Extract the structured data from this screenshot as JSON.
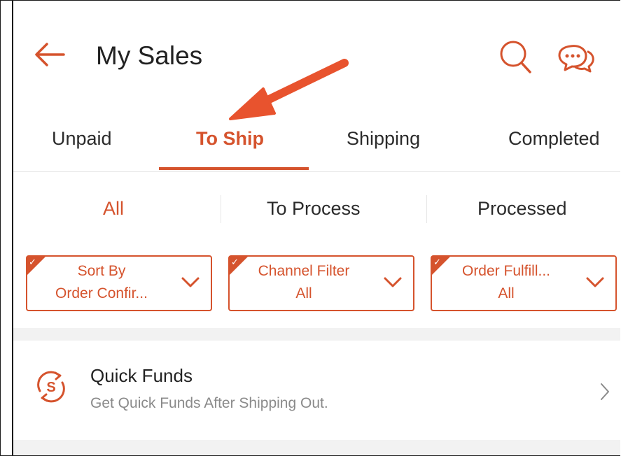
{
  "header": {
    "title": "My Sales",
    "back_icon": "arrow-left-icon",
    "search_icon": "search-icon",
    "chat_icon": "chat-bubble-icon"
  },
  "tabs": [
    {
      "label": "Unpaid",
      "active": false
    },
    {
      "label": "To Ship",
      "active": true
    },
    {
      "label": "Shipping",
      "active": false
    },
    {
      "label": "Completed",
      "active": false
    }
  ],
  "subtabs": [
    {
      "label": "All",
      "active": true
    },
    {
      "label": "To Process",
      "active": false
    },
    {
      "label": "Processed",
      "active": false
    }
  ],
  "filters": [
    {
      "line1": "Sort By",
      "line2": "Order Confir..."
    },
    {
      "line1": "Channel Filter",
      "line2": "All"
    },
    {
      "line1": "Order Fulfill...",
      "line2": "All"
    }
  ],
  "quick_funds": {
    "title": "Quick Funds",
    "subtitle": "Get Quick Funds After Shipping Out.",
    "icon": "quick-funds-coin-icon"
  },
  "colors": {
    "accent": "#d5532d",
    "annotation_arrow": "#e8532e"
  }
}
